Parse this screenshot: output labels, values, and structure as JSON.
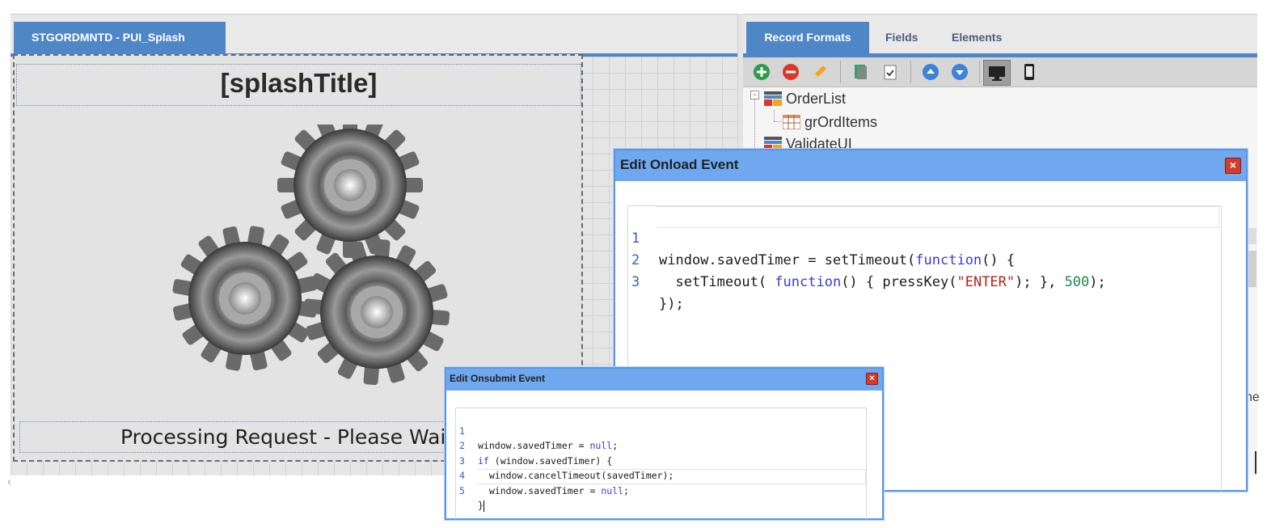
{
  "designer": {
    "tab_label": "STGORDMNTD - PUI_Splash",
    "splash_title": "[splashTitle]",
    "processing_text": "Processing Request - Please Wai"
  },
  "right_panel": {
    "tabs": [
      {
        "label": "Record Formats",
        "active": true
      },
      {
        "label": "Fields",
        "active": false
      },
      {
        "label": "Elements",
        "active": false
      }
    ],
    "toolbar_icons": [
      "add-icon",
      "remove-icon",
      "edit-pencil-icon",
      "copy-icon",
      "checklist-icon",
      "move-up-icon",
      "move-down-icon",
      "desktop-view-icon",
      "mobile-view-icon"
    ],
    "tree_items": [
      {
        "label": "OrderList",
        "icon": "record-format-icon"
      },
      {
        "label": "grOrdItems",
        "icon": "grid-icon"
      },
      {
        "label": "ValidateUI",
        "icon": "record-format-icon"
      }
    ],
    "edge_text": "ne"
  },
  "onload_dialog": {
    "title": "Edit Onload Event",
    "close_label": "×",
    "lines": [
      {
        "n": "1",
        "text": "window.savedTimer = setTimeout(function() {"
      },
      {
        "n": "2",
        "text": "  setTimeout( function() { pressKey(\"ENTER\"); }, 500);"
      },
      {
        "n": "3",
        "text": "});"
      }
    ]
  },
  "onsubmit_dialog": {
    "title": "Edit Onsubmit Event",
    "close_label": "×",
    "lines": [
      {
        "n": "1",
        "text": "window.savedTimer = null;"
      },
      {
        "n": "2",
        "text": "if (window.savedTimer) {"
      },
      {
        "n": "3",
        "text": "  window.cancelTimeout(savedTimer);"
      },
      {
        "n": "4",
        "text": "  window.savedTimer = null;"
      },
      {
        "n": "5",
        "text": "}"
      }
    ]
  },
  "colors": {
    "accent": "#4f86c6",
    "dialog_title": "#6fa8ef",
    "keyword": "#3b3bd6",
    "string": "#b4231d",
    "number": "#1b8a4a"
  }
}
